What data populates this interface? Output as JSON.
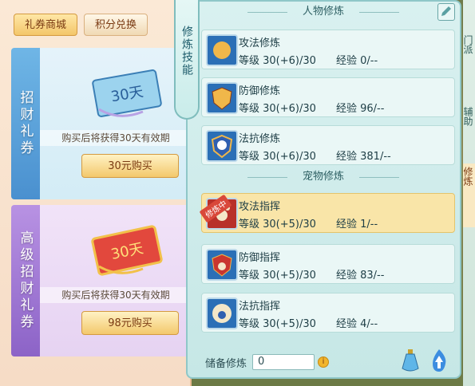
{
  "shop": {
    "tabs": [
      {
        "label": "礼券商城",
        "active": true
      },
      {
        "label": "积分兑换",
        "active": false
      }
    ],
    "cards": [
      {
        "vertical_label": "招财礼券",
        "ticket_text": "30天",
        "info": "购买后将获得30天有效期",
        "buy_label": "30元购买"
      },
      {
        "vertical_label": "高级招财礼券",
        "ticket_text": "30天",
        "info": "购买后将获得30天有效期",
        "buy_label": "98元购买"
      }
    ]
  },
  "panel": {
    "ribbon_title": "修炼技能",
    "section_person": "人物修炼",
    "section_pet": "宠物修炼",
    "person_rows": [
      {
        "name": "攻法修炼",
        "level": "等级 30(+6)/30",
        "exp": "经验 0/--",
        "icon": "fist-icon"
      },
      {
        "name": "防御修炼",
        "level": "等级 30(+6)/30",
        "exp": "经验 96/--",
        "icon": "shield-icon"
      },
      {
        "name": "法抗修炼",
        "level": "等级 30(+6)/30",
        "exp": "经验 381/--",
        "icon": "taiji-shield-icon"
      }
    ],
    "pet_rows": [
      {
        "name": "攻法指挥",
        "level": "等级 30(+5)/30",
        "exp": "经验 1/--",
        "icon": "paw-fist-icon",
        "tag": "修炼中",
        "active": true
      },
      {
        "name": "防御指挥",
        "level": "等级 30(+5)/30",
        "exp": "经验 83/--",
        "icon": "paw-shield-icon"
      },
      {
        "name": "法抗指挥",
        "level": "等级 30(+5)/30",
        "exp": "经验 4/--",
        "icon": "paw-taiji-icon"
      }
    ],
    "reserve_label": "储备修炼",
    "reserve_value": "0",
    "coin_symbol": "i"
  },
  "side_tabs": [
    "门派",
    "辅助",
    "修炼"
  ]
}
